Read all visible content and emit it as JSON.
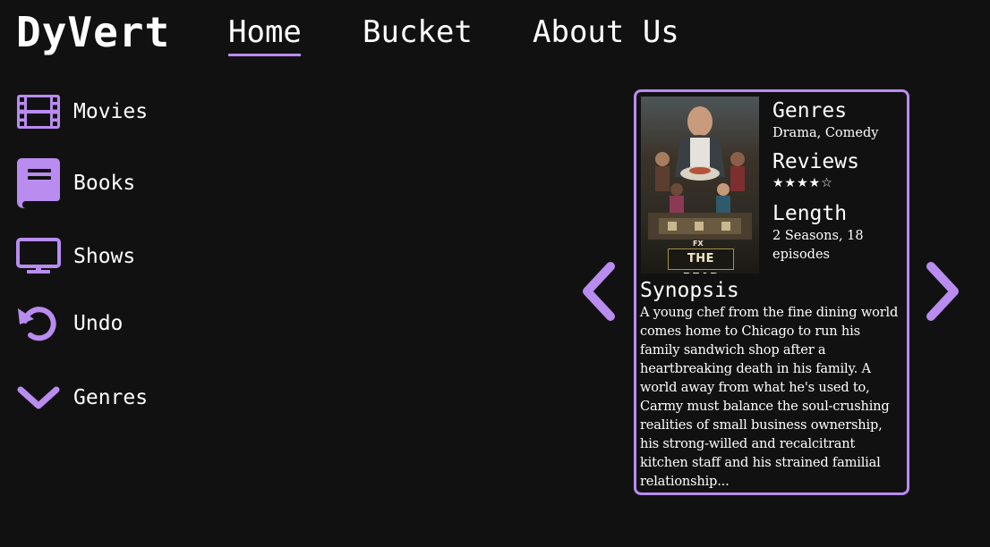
{
  "app": {
    "logo": "DyVert"
  },
  "nav": {
    "items": [
      {
        "label": "Home",
        "active": true
      },
      {
        "label": "Bucket",
        "active": false
      },
      {
        "label": "About Us",
        "active": false
      }
    ]
  },
  "sidebar": {
    "items": [
      {
        "label": "Movies",
        "icon": "film-icon"
      },
      {
        "label": "Books",
        "icon": "book-icon"
      },
      {
        "label": "Shows",
        "icon": "monitor-icon"
      },
      {
        "label": "Undo",
        "icon": "undo-icon"
      },
      {
        "label": "Genres",
        "icon": "chevron-down-icon"
      }
    ]
  },
  "card": {
    "poster_title": "THE BEAR",
    "poster_badge": "FX",
    "genres_heading": "Genres",
    "genres_value": "Drama, Comedy",
    "reviews_heading": "Reviews",
    "reviews_stars": "★★★★☆",
    "rating": 4,
    "rating_max": 5,
    "length_heading": "Length",
    "length_value": "2 Seasons, 18 episodes",
    "synopsis_heading": "Synopsis",
    "synopsis_text": "A young chef from the fine dining world comes home to Chicago to run his family sandwich shop after a heartbreaking death in his family. A world away from what he's used to, Carmy must balance the soul-crushing realities of small business ownership, his strong-willed and recalcitrant kitchen staff and his strained familial relationship..."
  },
  "colors": {
    "accent": "#b98cf0",
    "background": "#121112",
    "text": "#ffffff"
  }
}
